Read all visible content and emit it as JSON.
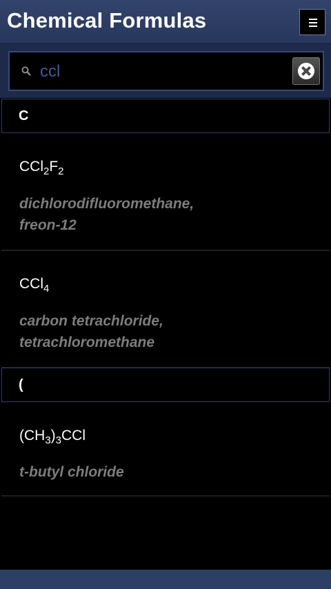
{
  "app": {
    "title": "Chemical Formulas",
    "menu_icon": "menu-icon"
  },
  "search": {
    "value": "ccl",
    "search_icon": "search-icon",
    "clear_icon": "clear-icon"
  },
  "sections": [
    {
      "letter": "C",
      "items": [
        {
          "formula": [
            "CCl",
            "2",
            "F",
            "2"
          ],
          "name_line1": "dichlorodifluoromethane,",
          "name_line2": "freon-12"
        },
        {
          "formula": [
            "CCl",
            "4"
          ],
          "name_line1": "carbon tetrachloride,",
          "name_line2": "tetrachloromethane"
        }
      ]
    },
    {
      "letter": "(",
      "items": [
        {
          "formula": [
            "(CH",
            "3",
            ")",
            "3",
            "CCl"
          ],
          "name_line1": "t-butyl chloride"
        }
      ]
    }
  ],
  "colors": {
    "header": "#2b3b62",
    "accent_border": "#2f3f68",
    "name_text": "#7d7d7d"
  }
}
